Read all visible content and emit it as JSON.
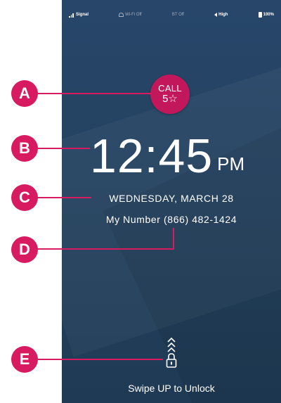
{
  "status_bar": {
    "signal_label": "Signal",
    "wifi_label": "Wi-Fi Off",
    "bt_label": "BT Off",
    "volume_label": "High",
    "battery_label": "100%"
  },
  "call_button": {
    "label": "CALL",
    "number": "5☆"
  },
  "clock": {
    "time": "12:45",
    "ampm": "PM",
    "date": "WEDNESDAY, MARCH 28"
  },
  "my_number": "My Number (866) 482-1424",
  "unlock": {
    "swipe_label": "Swipe UP to Unlock"
  },
  "callouts": {
    "a": "A",
    "b": "B",
    "c": "C",
    "d": "D",
    "e": "E"
  },
  "colors": {
    "callout": "#d81b60",
    "call_button": "#c2185b",
    "screen_bg": "#24425f"
  }
}
